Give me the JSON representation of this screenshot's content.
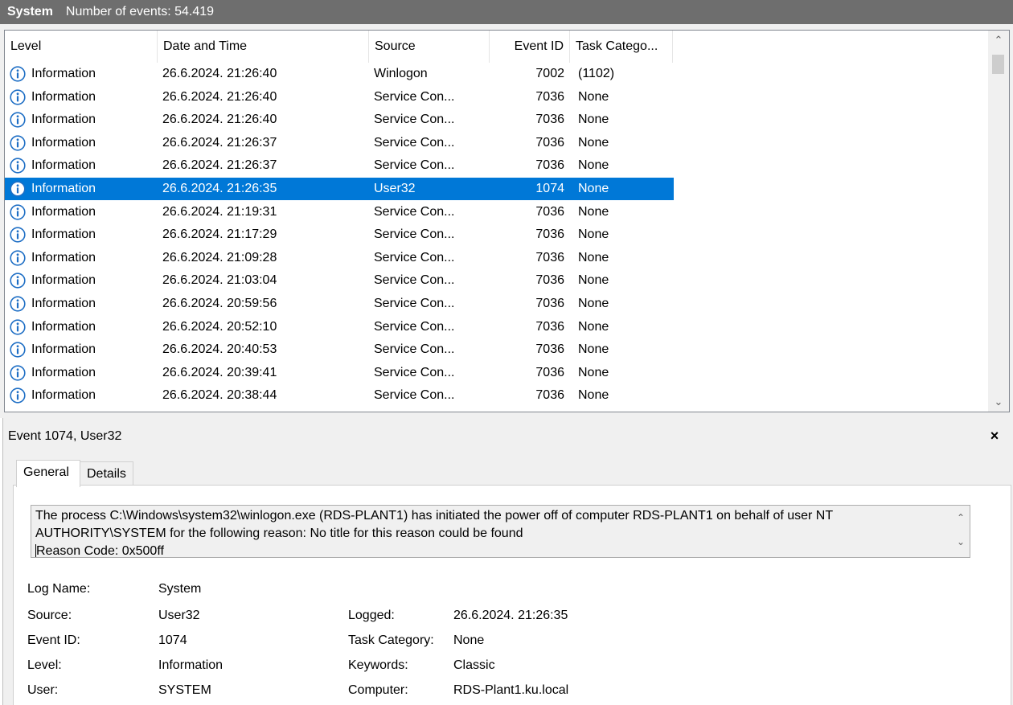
{
  "titlebar": {
    "log": "System",
    "count": "Number of events: 54.419"
  },
  "columns": {
    "level": "Level",
    "datetime": "Date and Time",
    "source": "Source",
    "event_id": "Event ID",
    "task_category": "Task Catego..."
  },
  "events": [
    {
      "level": "Information",
      "datetime": "26.6.2024. 21:26:40",
      "source": "Winlogon",
      "event_id": "7002",
      "task_category": "(1102)"
    },
    {
      "level": "Information",
      "datetime": "26.6.2024. 21:26:40",
      "source": "Service Con...",
      "event_id": "7036",
      "task_category": "None"
    },
    {
      "level": "Information",
      "datetime": "26.6.2024. 21:26:40",
      "source": "Service Con...",
      "event_id": "7036",
      "task_category": "None"
    },
    {
      "level": "Information",
      "datetime": "26.6.2024. 21:26:37",
      "source": "Service Con...",
      "event_id": "7036",
      "task_category": "None"
    },
    {
      "level": "Information",
      "datetime": "26.6.2024. 21:26:37",
      "source": "Service Con...",
      "event_id": "7036",
      "task_category": "None"
    },
    {
      "level": "Information",
      "datetime": "26.6.2024. 21:26:35",
      "source": "User32",
      "event_id": "1074",
      "task_category": "None",
      "selected": true
    },
    {
      "level": "Information",
      "datetime": "26.6.2024. 21:19:31",
      "source": "Service Con...",
      "event_id": "7036",
      "task_category": "None"
    },
    {
      "level": "Information",
      "datetime": "26.6.2024. 21:17:29",
      "source": "Service Con...",
      "event_id": "7036",
      "task_category": "None"
    },
    {
      "level": "Information",
      "datetime": "26.6.2024. 21:09:28",
      "source": "Service Con...",
      "event_id": "7036",
      "task_category": "None"
    },
    {
      "level": "Information",
      "datetime": "26.6.2024. 21:03:04",
      "source": "Service Con...",
      "event_id": "7036",
      "task_category": "None"
    },
    {
      "level": "Information",
      "datetime": "26.6.2024. 20:59:56",
      "source": "Service Con...",
      "event_id": "7036",
      "task_category": "None"
    },
    {
      "level": "Information",
      "datetime": "26.6.2024. 20:52:10",
      "source": "Service Con...",
      "event_id": "7036",
      "task_category": "None"
    },
    {
      "level": "Information",
      "datetime": "26.6.2024. 20:40:53",
      "source": "Service Con...",
      "event_id": "7036",
      "task_category": "None"
    },
    {
      "level": "Information",
      "datetime": "26.6.2024. 20:39:41",
      "source": "Service Con...",
      "event_id": "7036",
      "task_category": "None"
    },
    {
      "level": "Information",
      "datetime": "26.6.2024. 20:38:44",
      "source": "Service Con...",
      "event_id": "7036",
      "task_category": "None"
    }
  ],
  "icons": {
    "level": "info-icon",
    "scroll_up": "chevron-up-icon",
    "scroll_down": "chevron-down-icon",
    "close": "close-icon"
  },
  "colors": {
    "selection": "#0078d7",
    "info_icon": "#1f6fc5",
    "titlebar": "#6e6e6e"
  },
  "detail": {
    "title": "Event 1074, User32",
    "close_label": "×",
    "tabs": {
      "general": "General",
      "details": "Details"
    },
    "description_lines": [
      "The process C:\\Windows\\system32\\winlogon.exe (RDS-PLANT1) has initiated the power off of computer RDS-PLANT1 on behalf of user NT",
      "AUTHORITY\\SYSTEM for the following reason: No title for this reason could be found",
      " Reason Code: 0x500ff"
    ],
    "props": {
      "log_name_label": "Log Name:",
      "log_name": "System",
      "source_label": "Source:",
      "source": "User32",
      "logged_label": "Logged:",
      "logged": "26.6.2024. 21:26:35",
      "event_id_label": "Event ID:",
      "event_id": "1074",
      "task_category_label": "Task Category:",
      "task_category": "None",
      "level_label": "Level:",
      "level": "Information",
      "keywords_label": "Keywords:",
      "keywords": "Classic",
      "user_label": "User:",
      "user": "SYSTEM",
      "computer_label": "Computer:",
      "computer": "RDS-Plant1.ku.local"
    }
  }
}
